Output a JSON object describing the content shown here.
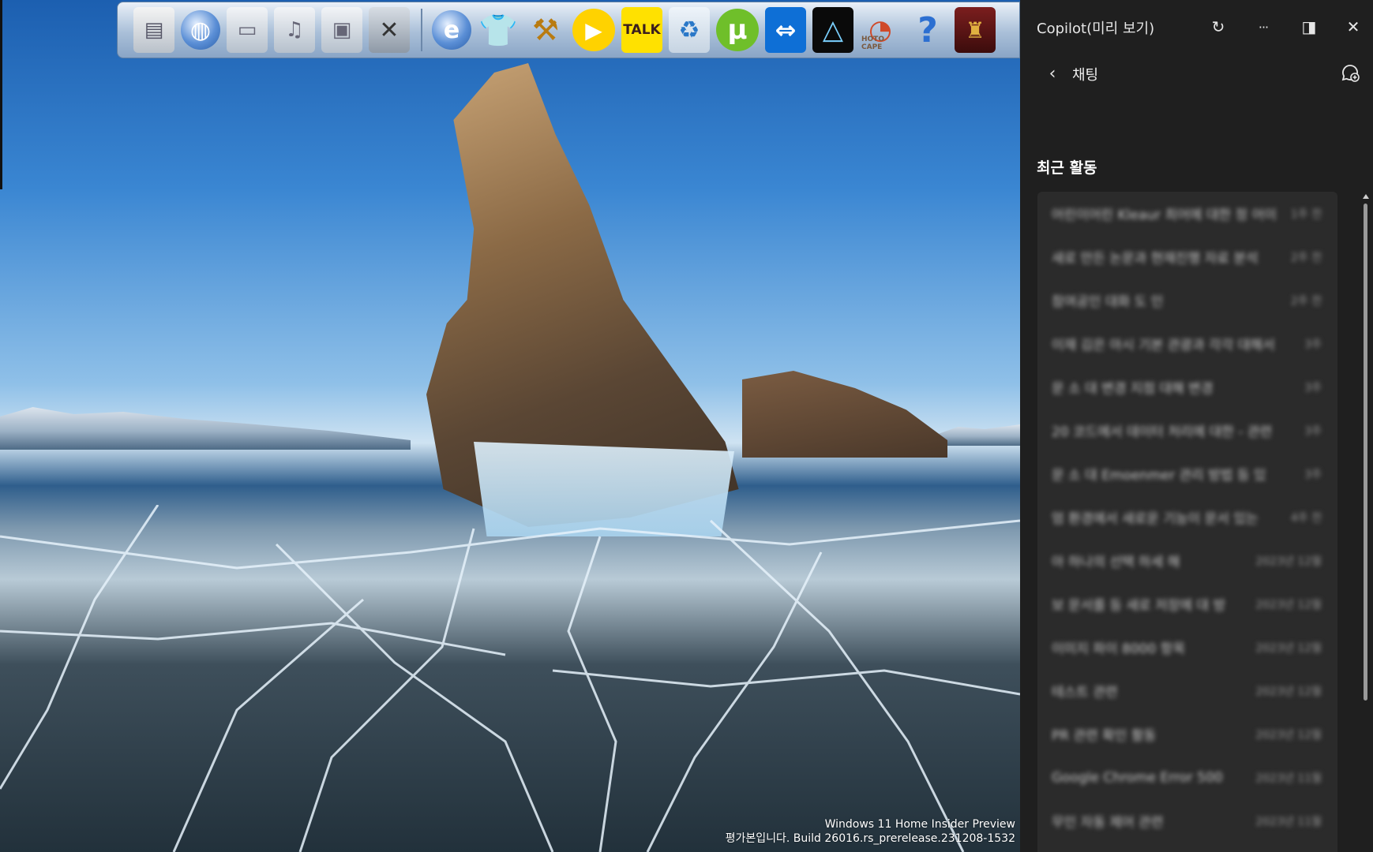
{
  "toolbar": {
    "icons": [
      {
        "name": "document-icon",
        "glyph": "▤"
      },
      {
        "name": "globe-network-icon",
        "glyph": "◍"
      },
      {
        "name": "folder-icon",
        "glyph": "▭"
      },
      {
        "name": "music-folder-icon",
        "glyph": "♫"
      },
      {
        "name": "pictures-folder-icon",
        "glyph": "▣"
      },
      {
        "name": "tools-icon",
        "glyph": "✕"
      },
      {
        "name": "internet-explorer-icon",
        "glyph": "e"
      },
      {
        "name": "tshirt-icon",
        "glyph": "👕"
      },
      {
        "name": "hammer-icon",
        "glyph": "⚒"
      },
      {
        "name": "media-player-icon",
        "glyph": "▶"
      },
      {
        "name": "kakaotalk-icon",
        "glyph": "TALK"
      },
      {
        "name": "recycle-bin-icon",
        "glyph": "♻"
      },
      {
        "name": "utorrent-icon",
        "glyph": "µ"
      },
      {
        "name": "teamviewer-icon",
        "glyph": "⇔"
      },
      {
        "name": "triangle-app-icon",
        "glyph": "△"
      },
      {
        "name": "photoscape-icon",
        "glyph": "◔"
      },
      {
        "name": "help-icon",
        "glyph": "?"
      },
      {
        "name": "game-icon",
        "glyph": "♜"
      }
    ],
    "photoscape_label": "HOTO CAPE"
  },
  "desktop": {
    "watermark_line1": "Windows 11 Home Insider Preview",
    "watermark_line2": "평가본입니다. Build 26016.rs_prerelease.231208-1532"
  },
  "copilot": {
    "title": "Copilot(미리 보기)",
    "nav_title": "채팅",
    "section_title": "최근 활동",
    "refresh_glyph": "↻",
    "more_glyph": "···",
    "dock_glyph": "◨",
    "close_glyph": "✕",
    "back_glyph": "‹",
    "chats": [
      {
        "title": "어린이어린 Kleaur 최어에 대한 정 어이",
        "time": "1주 전"
      },
      {
        "title": "새로 만든 논문과 현재진행 자료 분석",
        "time": "2주 전"
      },
      {
        "title": "참여공인 대화 도 인",
        "time": "2주 전"
      },
      {
        "title": "이재 김은 아시 기본 관광과 각각 대해서",
        "time": "3주"
      },
      {
        "title": "문 소 대 변경 지점 대해 변경",
        "time": "3주"
      },
      {
        "title": "20 코드에서 데이터 처리에 대한 - 관련",
        "time": "3주"
      },
      {
        "title": "문 소 대 Emoenmer 관리 방법 등 있",
        "time": "3주"
      },
      {
        "title": "엄 환경에서 새로운 기능이 문서 있는",
        "time": "4주 전"
      },
      {
        "title": "아 하나의 선택 하세 해",
        "time": "2023년 12월"
      },
      {
        "title": "보 문서를 등 새로 저장에 대 방",
        "time": "2023년 12월"
      },
      {
        "title": "이미지 파이 8000 항목",
        "time": "2023년 12월"
      },
      {
        "title": "테스트 관련",
        "time": "2023년 12월"
      },
      {
        "title": "PR 관련 확인 활동",
        "time": "2023년 12월"
      },
      {
        "title": "Google Chrome Error 500",
        "time": "2023년 11월"
      },
      {
        "title": "무인 자동 제어 관련",
        "time": "2023년 11월"
      }
    ]
  }
}
